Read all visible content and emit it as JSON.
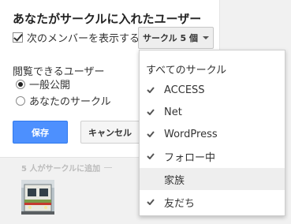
{
  "share": {
    "title": "あなたがサークルに入れたユーザー",
    "show_members_label": "次のメンバーを表示する",
    "circles_button_label": "サークル 5 個",
    "visibility_label": "閲覧できるユーザー",
    "radio_options": [
      "一般公開",
      "あなたのサークル"
    ],
    "save_label": "保存",
    "cancel_label": "キャンセル",
    "added_label": "5 人がサークルに追加"
  },
  "dropdown": {
    "header": "すべてのサークル",
    "items": [
      {
        "label": "ACCESS",
        "checked": true
      },
      {
        "label": "Net",
        "checked": true
      },
      {
        "label": "WordPress",
        "checked": true
      },
      {
        "label": "フォロー中",
        "checked": true
      },
      {
        "label": "家族",
        "checked": false
      },
      {
        "label": "友だち",
        "checked": true
      }
    ]
  },
  "colors": {
    "primary_button": "#4d90fe",
    "hover_row": "#eeeeee"
  }
}
